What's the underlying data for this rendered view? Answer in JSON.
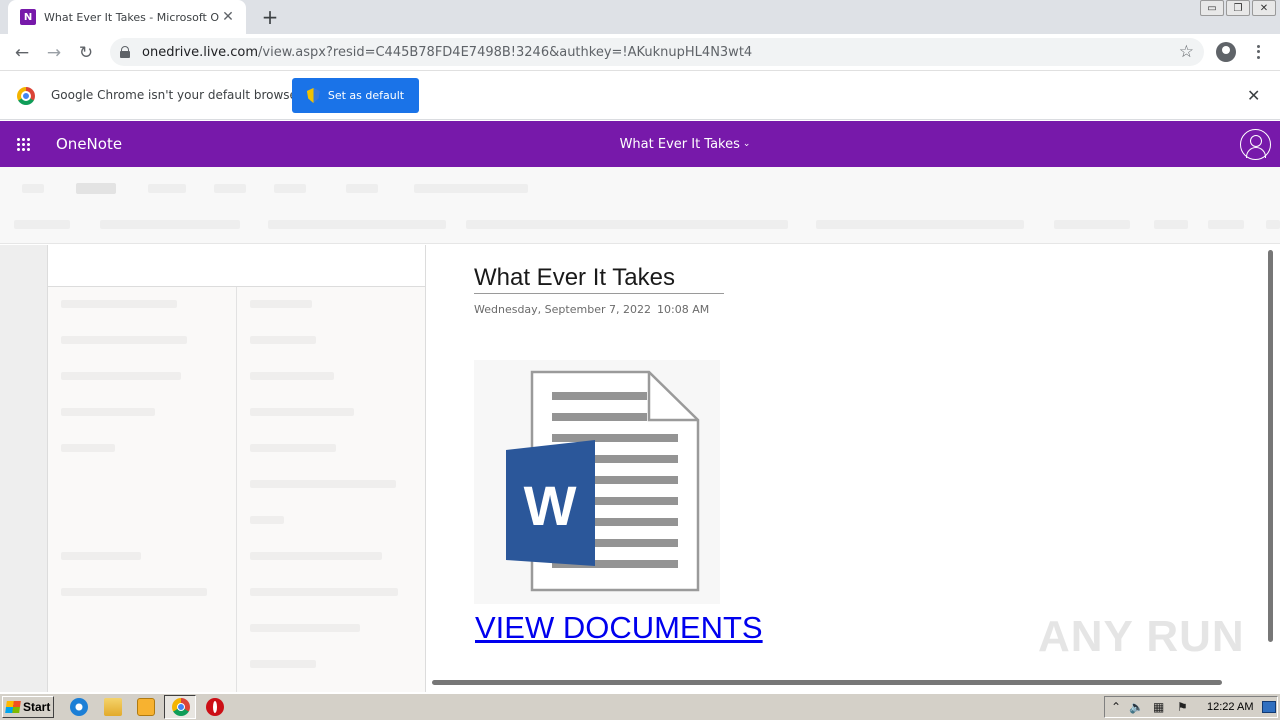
{
  "browser": {
    "tab_title": "What Ever It Takes - Microsoft OneNote",
    "tab_favicon_letter": "N",
    "tab_close": "✕",
    "new_tab": "+",
    "url_host": "onedrive.live.com",
    "url_path": "/view.aspx?resid=C445B78FD4E7498B!3246&authkey=!AKuknupHL4N3wt4",
    "window_buttons": [
      "▭",
      "❐",
      "✕"
    ]
  },
  "infobar": {
    "message": "Google Chrome isn't your default browser",
    "button_label": "Set as default",
    "close": "✕"
  },
  "onenote": {
    "app_name": "OneNote",
    "notebook_title": "What Ever It Takes",
    "accent_color": "#7719aa"
  },
  "page": {
    "title": "What Ever It Takes",
    "date": "Wednesday, September 7, 2022",
    "time": "10:08 AM",
    "image_icon": "word-document-icon",
    "image_letter": "W",
    "link_text": "VIEW DOCUMENTS"
  },
  "watermark": "ANY RUN",
  "taskbar": {
    "start_label": "Start",
    "clock": "12:22 AM"
  }
}
